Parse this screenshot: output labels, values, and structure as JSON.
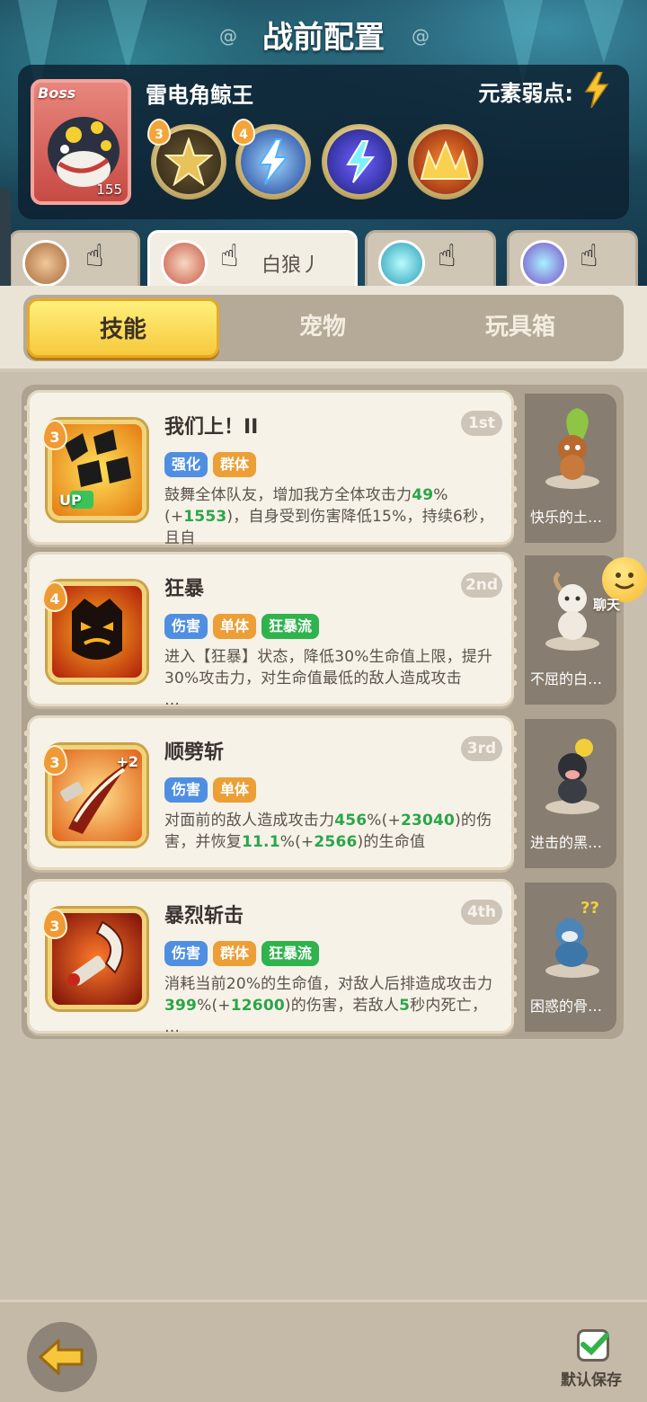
{
  "header": {
    "title": "战前配置"
  },
  "boss": {
    "tag": "Boss",
    "level": "155",
    "name": "雷电角鲸王",
    "weakness_label": "元素弱点:",
    "skills": [
      {
        "level": "3",
        "icon": "golden-star-burst-icon"
      },
      {
        "level": "4",
        "icon": "blue-lightning-icon"
      },
      {
        "level": "",
        "icon": "lightning-bolt-icon"
      },
      {
        "level": "",
        "icon": "golden-spikes-icon"
      }
    ]
  },
  "hero_tabs": [
    {
      "name": "",
      "icon": "hero-avatar-1"
    },
    {
      "name": "白狼丿",
      "icon": "hero-avatar-2"
    },
    {
      "name": "",
      "icon": "hero-avatar-3"
    },
    {
      "name": "",
      "icon": "hero-avatar-4"
    }
  ],
  "sections": {
    "skills": "技能",
    "pets": "宠物",
    "toybox": "玩具箱",
    "active": "skills"
  },
  "skills": [
    {
      "level": "3",
      "title": "我们上！II",
      "rank": "1st",
      "tags": [
        {
          "text": "强化",
          "color": "blue"
        },
        {
          "text": "群体",
          "color": "orange"
        }
      ],
      "desc_parts": [
        "鼓舞全体队友，增加我方全体攻击力",
        "49",
        "%(+",
        "1553",
        ")，自身受到伤害降低15%，持续6秒，且自",
        "…"
      ],
      "icon_badge": "UP",
      "pet_name": "快乐的土…"
    },
    {
      "level": "4",
      "title": "狂暴",
      "rank": "2nd",
      "tags": [
        {
          "text": "伤害",
          "color": "blue"
        },
        {
          "text": "单体",
          "color": "orange"
        },
        {
          "text": "狂暴流",
          "color": "green"
        }
      ],
      "desc_parts": [
        "进入【狂暴】状态，降低30%生命值上限，提升30%攻击力，对生命值最低的敌人造成攻击",
        "…"
      ],
      "icon_badge": "",
      "pet_name": "不屈的白…"
    },
    {
      "level": "3",
      "title": "顺劈斩",
      "rank": "3rd",
      "tags": [
        {
          "text": "伤害",
          "color": "blue"
        },
        {
          "text": "单体",
          "color": "orange"
        }
      ],
      "desc_parts": [
        "对面前的敌人造成攻击力",
        "456",
        "%(+",
        "23040",
        ")的伤害，并恢复",
        "11.1",
        "%(+",
        "2566",
        ")的生命值"
      ],
      "icon_badge": "+2",
      "pet_name": "进击的黑…"
    },
    {
      "level": "3",
      "title": "暴烈斩击",
      "rank": "4th",
      "tags": [
        {
          "text": "伤害",
          "color": "blue"
        },
        {
          "text": "群体",
          "color": "orange"
        },
        {
          "text": "狂暴流",
          "color": "green"
        }
      ],
      "desc_parts": [
        "消耗当前20%的生命值，对敌人后排造成攻击力",
        "399",
        "%(+",
        "12600",
        ")的伤害，若敌人",
        "5",
        "秒内死亡，",
        "…"
      ],
      "icon_badge": "",
      "pet_name": "困惑的骨…"
    }
  ],
  "chat": {
    "label": "聊天"
  },
  "footer": {
    "save_label": "默认保存",
    "save_checked": true
  }
}
